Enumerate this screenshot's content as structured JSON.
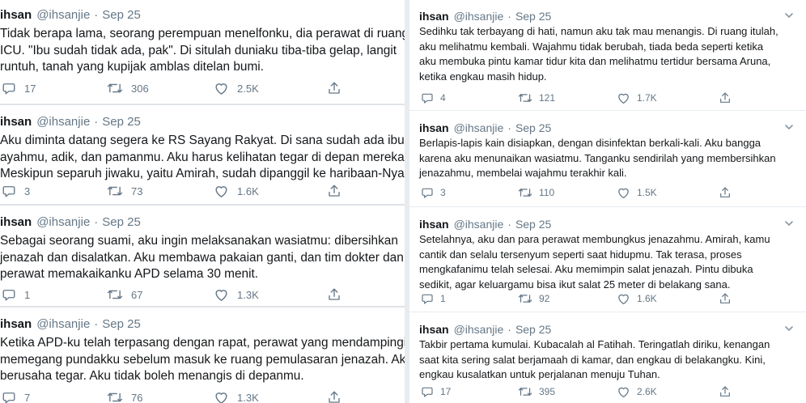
{
  "colors": {
    "text": "#14171a",
    "muted": "#657786",
    "divider": "#e6ecf0"
  },
  "left_column": {
    "tweets": [
      {
        "name": "ihsan",
        "handle": "@ihsanjie",
        "dot": "·",
        "date": "Sep 25",
        "text": "Tidak berapa lama, seorang perempuan menelfonku, dia perawat di ruanga\nICU. \"Ibu sudah tidak ada, pak\". Di situlah duniaku tiba-tiba gelap, langit\nruntuh, tanah yang kupijak amblas ditelan bumi.",
        "replies": "17",
        "retweets": "306",
        "likes": "2.5K"
      },
      {
        "name": "ihsan",
        "handle": "@ihsanjie",
        "dot": "·",
        "date": "Sep 25",
        "text": "Aku diminta datang segera ke RS Sayang Rakyat. Di sana sudah ada ibumu,\nayahmu, adik, dan pamanmu. Aku harus kelihatan tegar di depan mereka.\nMeskipun separuh jiwaku, yaitu Amirah, sudah dipanggil ke haribaan-Nya.",
        "replies": "3",
        "retweets": "73",
        "likes": "1.6K"
      },
      {
        "name": "ihsan",
        "handle": "@ihsanjie",
        "dot": "·",
        "date": "Sep 25",
        "text": "Sebagai seorang suami, aku ingin melaksanakan wasiatmu: dibersihkan\njenazah dan disalatkan. Aku membawa pakaian ganti, dan tim dokter dan\nperawat memakaikanku APD selama 30 menit.",
        "replies": "1",
        "retweets": "67",
        "likes": "1.3K"
      },
      {
        "name": "ihsan",
        "handle": "@ihsanjie",
        "dot": "·",
        "date": "Sep 25",
        "text": "Ketika APD-ku telah terpasang dengan rapat, perawat yang mendampingi\nmemegang pundakku sebelum masuk ke ruang pemulasaran jenazah. Aku\nberusaha tegar. Aku tidak boleh menangis di depanmu.",
        "replies": "7",
        "retweets": "76",
        "likes": "1.3K"
      }
    ]
  },
  "right_column": {
    "tweets": [
      {
        "name": "ihsan",
        "handle": "@ihsanjie",
        "dot": "·",
        "date": "Sep 25",
        "text": "Sedihku tak terbayang di hati, namun aku tak mau menangis. Di ruang itulah,\naku melihatmu kembali. Wajahmu tidak berubah, tiada beda seperti ketika\naku membuka pintu kamar tidur kita dan melihatmu tertidur bersama Aruna,\nketika engkau masih hidup.",
        "replies": "4",
        "retweets": "121",
        "likes": "1.7K"
      },
      {
        "name": "ihsan",
        "handle": "@ihsanjie",
        "dot": "·",
        "date": "Sep 25",
        "text": "Berlapis-lapis kain disiapkan, dengan disinfektan berkali-kali. Aku bangga\nkarena aku menunaikan wasiatmu. Tanganku sendirilah yang membersihkan\njenazahmu, membelai wajahmu terakhir kali.",
        "replies": "3",
        "retweets": "110",
        "likes": "1.5K"
      },
      {
        "name": "ihsan",
        "handle": "@ihsanjie",
        "dot": "·",
        "date": "Sep 25",
        "text": "Setelahnya, aku dan para perawat membungkus jenazahmu. Amirah, kamu\ncantik dan selalu tersenyum seperti saat hidupmu. Tak terasa, proses\nmengkafanimu telah selesai. Aku memimpin salat jenazah. Pintu dibuka\nsedikit, agar keluargamu bisa ikut salat 25 meter di belakang sana.",
        "replies": "1",
        "retweets": "92",
        "likes": "1.6K"
      },
      {
        "name": "ihsan",
        "handle": "@ihsanjie",
        "dot": "·",
        "date": "Sep 25",
        "text": "Takbir pertama kumulai. Kubacalah al Fatihah. Teringatlah diriku, kenangan\nsaat kita sering salat berjamaah di kamar, dan engkau di belakangku. Kini,\nengkau kusalatkan untuk perjalanan menuju Tuhan.",
        "replies": "17",
        "retweets": "395",
        "likes": "2.6K"
      }
    ]
  }
}
